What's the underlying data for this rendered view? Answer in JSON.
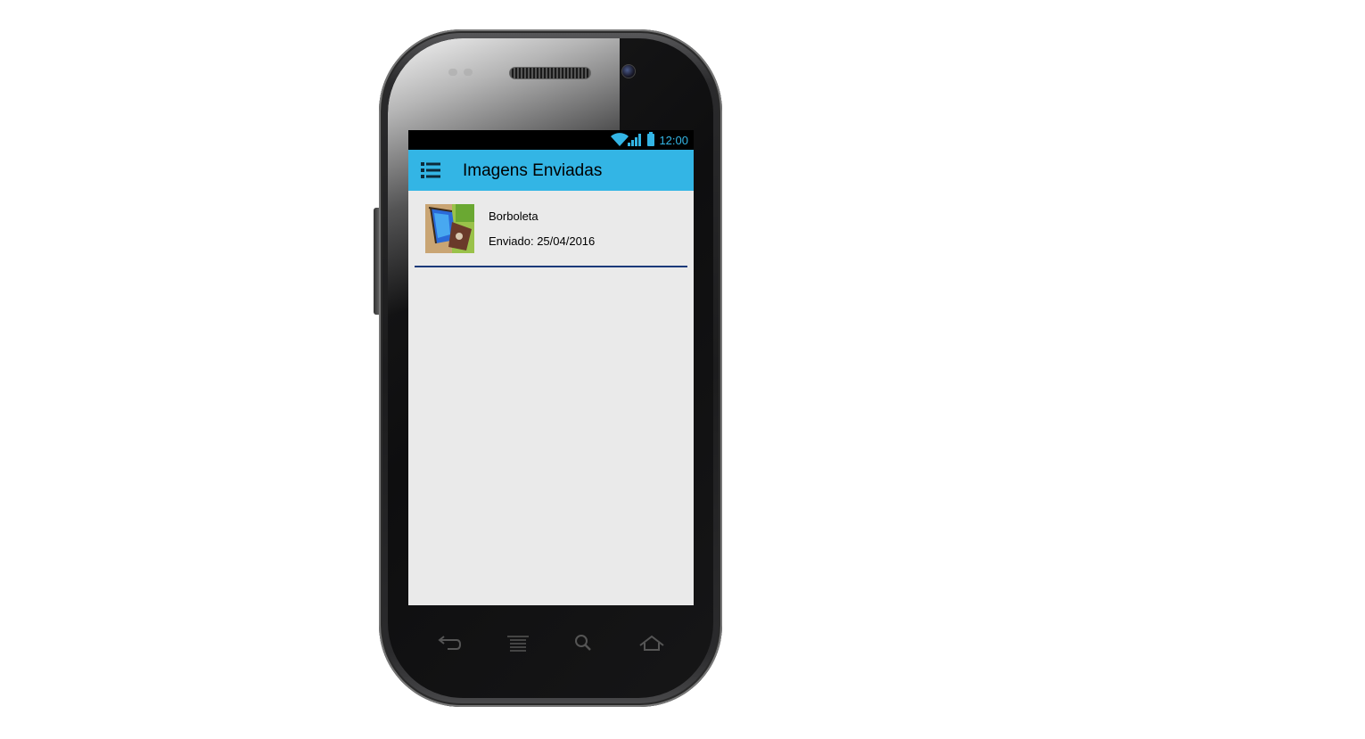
{
  "status_bar": {
    "time": "12:00",
    "icons": [
      "wifi-icon",
      "signal-icon",
      "battery-icon"
    ]
  },
  "app_bar": {
    "title": "Imagens Enviadas",
    "menu_icon": "list-menu-icon"
  },
  "list": {
    "items": [
      {
        "title": "Borboleta",
        "date_text": "Enviado: 25/04/2016",
        "thumbnail": "butterfly-thumbnail"
      }
    ]
  },
  "nav_buttons": [
    "back-icon",
    "recent-apps-icon",
    "search-icon",
    "home-icon"
  ],
  "colors": {
    "accent": "#33b5e5",
    "background": "#eaeaea",
    "divider": "#1a3a7a",
    "status_bar": "#000000"
  }
}
